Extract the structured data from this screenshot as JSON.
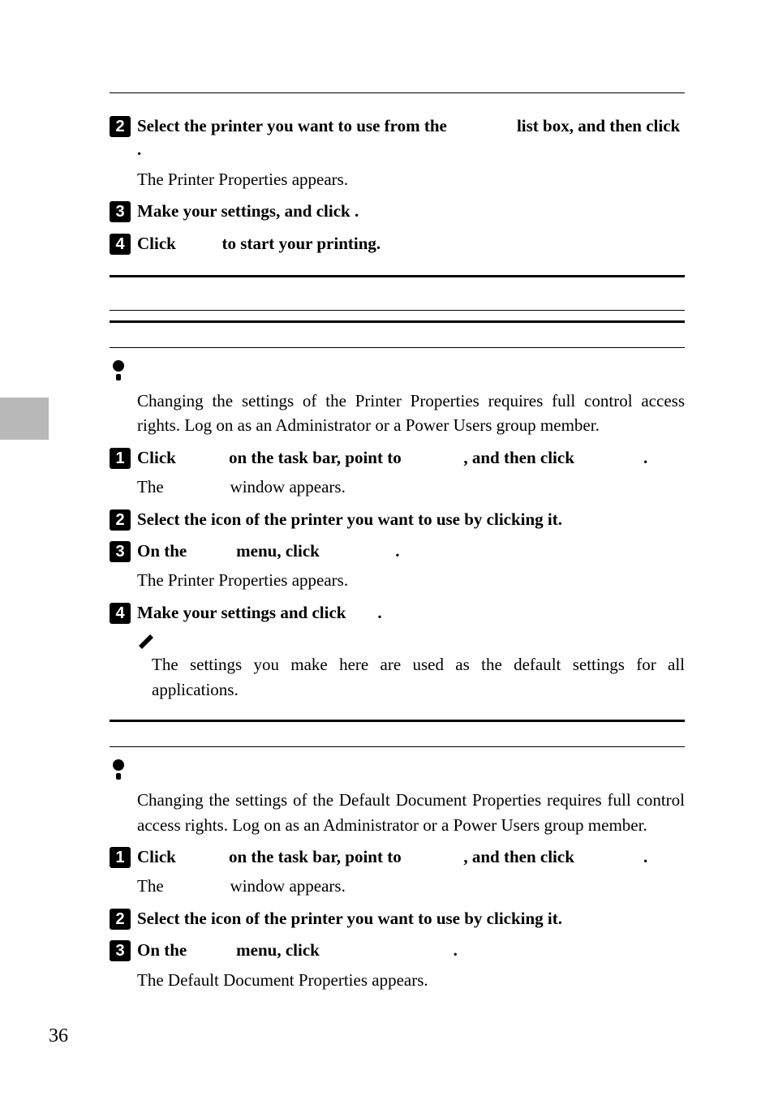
{
  "top_rule_present": true,
  "steps_group_a": [
    {
      "num": "2",
      "bold_parts": [
        "Select the printer you want to use from the ",
        " list box, and then click ",
        "."
      ],
      "gap_widths": [
        "3.6em",
        "0"
      ],
      "sub": "The Printer Properties appears."
    },
    {
      "num": "3",
      "bold_parts": [
        "Make your settings, and click ",
        "."
      ],
      "gap_widths": [
        "0"
      ]
    },
    {
      "num": "4",
      "bold_parts": [
        "Click ",
        " to start your printing."
      ],
      "gap_widths": [
        "2.2em"
      ]
    }
  ],
  "section_b": {
    "limitation_para": "Changing the settings of the Printer Properties requires full control access rights. Log on as an Administrator or a Power Users group member.",
    "steps": [
      {
        "num": "1",
        "bold_parts": [
          "Click ",
          " on the task bar, point to ",
          ", and then click ",
          "."
        ],
        "gap_widths": [
          "2.6em",
          "3.4em",
          "3.8em"
        ],
        "sub_parts": [
          "The ",
          " window appears."
        ],
        "sub_gap_widths": [
          "3.4em"
        ]
      },
      {
        "num": "2",
        "bold_parts": [
          "Select the icon of the printer you want to use by clicking it."
        ],
        "gap_widths": []
      },
      {
        "num": "3",
        "bold_parts": [
          "On the ",
          " menu, click ",
          "."
        ],
        "gap_widths": [
          "2.4em",
          "4.2em"
        ],
        "sub": "The Printer Properties appears."
      },
      {
        "num": "4",
        "bold_parts": [
          "Make your settings and click ",
          "."
        ],
        "gap_widths": [
          "1.6em"
        ],
        "note": "The settings you make here are used as the default settings for all applications."
      }
    ]
  },
  "section_c": {
    "limitation_para": "Changing the settings of the Default Document Properties requires full control access rights. Log on as an Administrator or a Power Users group member.",
    "steps": [
      {
        "num": "1",
        "bold_parts": [
          "Click ",
          " on the task bar, point to ",
          ", and then click ",
          "."
        ],
        "gap_widths": [
          "2.6em",
          "3.4em",
          "3.8em"
        ],
        "sub_parts": [
          "The ",
          " window appears."
        ],
        "sub_gap_widths": [
          "3.4em"
        ]
      },
      {
        "num": "2",
        "bold_parts": [
          "Select the icon of the printer you want to use by clicking it."
        ],
        "gap_widths": []
      },
      {
        "num": "3",
        "bold_parts": [
          "On the ",
          " menu, click ",
          "."
        ],
        "gap_widths": [
          "2.4em",
          "7.6em"
        ],
        "sub": "The Default Document Properties appears."
      }
    ]
  },
  "page_number": "36"
}
